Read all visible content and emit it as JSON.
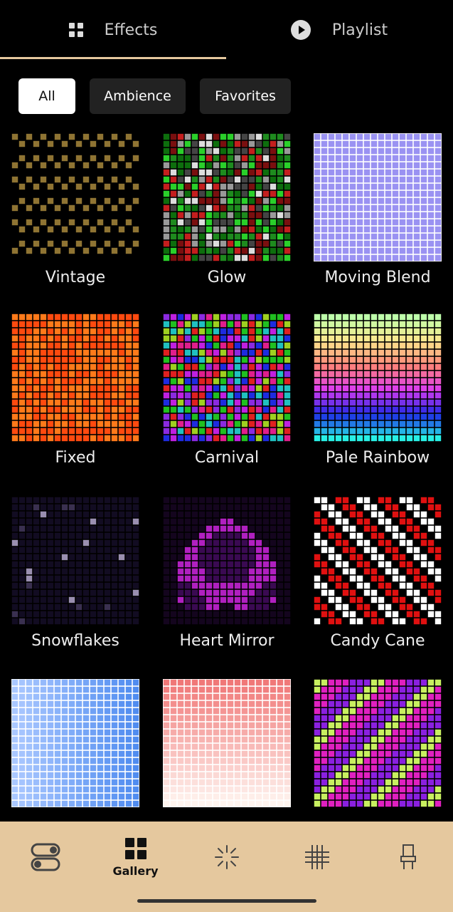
{
  "tabs": [
    {
      "label": "Effects",
      "icon": "grid-icon",
      "active": true
    },
    {
      "label": "Playlist",
      "icon": "play-circle-icon",
      "active": false
    }
  ],
  "filters": [
    {
      "label": "All",
      "active": true
    },
    {
      "label": "Ambience",
      "active": false
    },
    {
      "label": "Favorites",
      "active": false
    }
  ],
  "effects": [
    {
      "label": "Vintage",
      "pattern": "vintage"
    },
    {
      "label": "Glow",
      "pattern": "glow"
    },
    {
      "label": "Moving Blend",
      "pattern": "moving-blend"
    },
    {
      "label": "Fixed",
      "pattern": "fixed"
    },
    {
      "label": "Carnival",
      "pattern": "carnival"
    },
    {
      "label": "Pale Rainbow",
      "pattern": "pale-rainbow"
    },
    {
      "label": "Snowflakes",
      "pattern": "snowflakes"
    },
    {
      "label": "Heart Mirror",
      "pattern": "heart-mirror"
    },
    {
      "label": "Candy Cane",
      "pattern": "candy-cane"
    },
    {
      "label": "",
      "pattern": "blue-gradient"
    },
    {
      "label": "",
      "pattern": "pink-gradient"
    },
    {
      "label": "",
      "pattern": "pink-stripes"
    }
  ],
  "bottom_nav": [
    {
      "icon": "toggle-switches-icon",
      "label": ""
    },
    {
      "icon": "gallery-icon",
      "label": "Gallery",
      "active": true
    },
    {
      "icon": "sparkle-icon",
      "label": ""
    },
    {
      "icon": "grid-lines-icon",
      "label": ""
    },
    {
      "icon": "chair-icon",
      "label": ""
    }
  ],
  "colors": {
    "accent": "#e5c89e",
    "background": "#000000",
    "chip": "#222222"
  }
}
